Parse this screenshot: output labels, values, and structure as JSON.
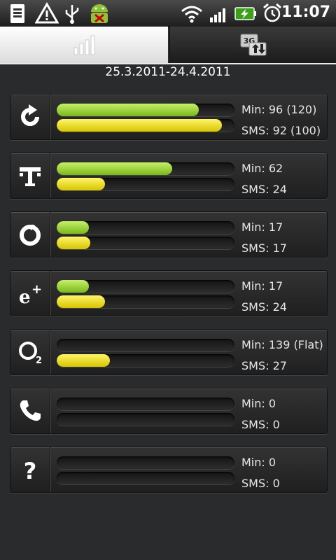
{
  "status_bar": {
    "time": "11:07",
    "icons": [
      "sim-card-icon",
      "warning-icon",
      "usb-icon",
      "android-debug-icon",
      "wifi-icon",
      "signal-icon",
      "battery-charging-icon",
      "alarm-icon"
    ]
  },
  "tabs": [
    {
      "name": "stats-tab",
      "icon": "bar-chart-icon",
      "active": true
    },
    {
      "name": "data-tab",
      "icon": "3g-transfer-icon",
      "active": false
    }
  ],
  "date_range": "25.3.2011-24.4.2011",
  "providers": [
    {
      "icon": "refresh-icon",
      "min_label": "Min: 96 (120)",
      "sms_label": "SMS: 92 (100)",
      "min_fill": 0.8,
      "sms_fill": 0.93
    },
    {
      "icon": "t-mobile-icon",
      "min_label": "Min: 62",
      "sms_label": "SMS: 24",
      "min_fill": 0.65,
      "sms_fill": 0.27
    },
    {
      "icon": "vodafone-icon",
      "min_label": "Min: 17",
      "sms_label": "SMS: 17",
      "min_fill": 0.18,
      "sms_fill": 0.19
    },
    {
      "icon": "eplus-icon",
      "min_label": "Min: 17",
      "sms_label": "SMS: 24",
      "min_fill": 0.18,
      "sms_fill": 0.27
    },
    {
      "icon": "o2-icon",
      "min_label": "Min: 139 (Flat)",
      "sms_label": "SMS: 27",
      "min_fill": 0.0,
      "sms_fill": 0.3
    },
    {
      "icon": "phone-icon",
      "min_label": "Min: 0",
      "sms_label": "SMS: 0",
      "min_fill": 0.0,
      "sms_fill": 0.0
    },
    {
      "icon": "unknown-icon",
      "min_label": "Min: 0",
      "sms_label": "SMS: 0",
      "min_fill": 0.0,
      "sms_fill": 0.0
    }
  ],
  "colors": {
    "minutes_bar": "#9bd435",
    "sms_bar": "#f0df14",
    "background": "#2a2b2d"
  }
}
